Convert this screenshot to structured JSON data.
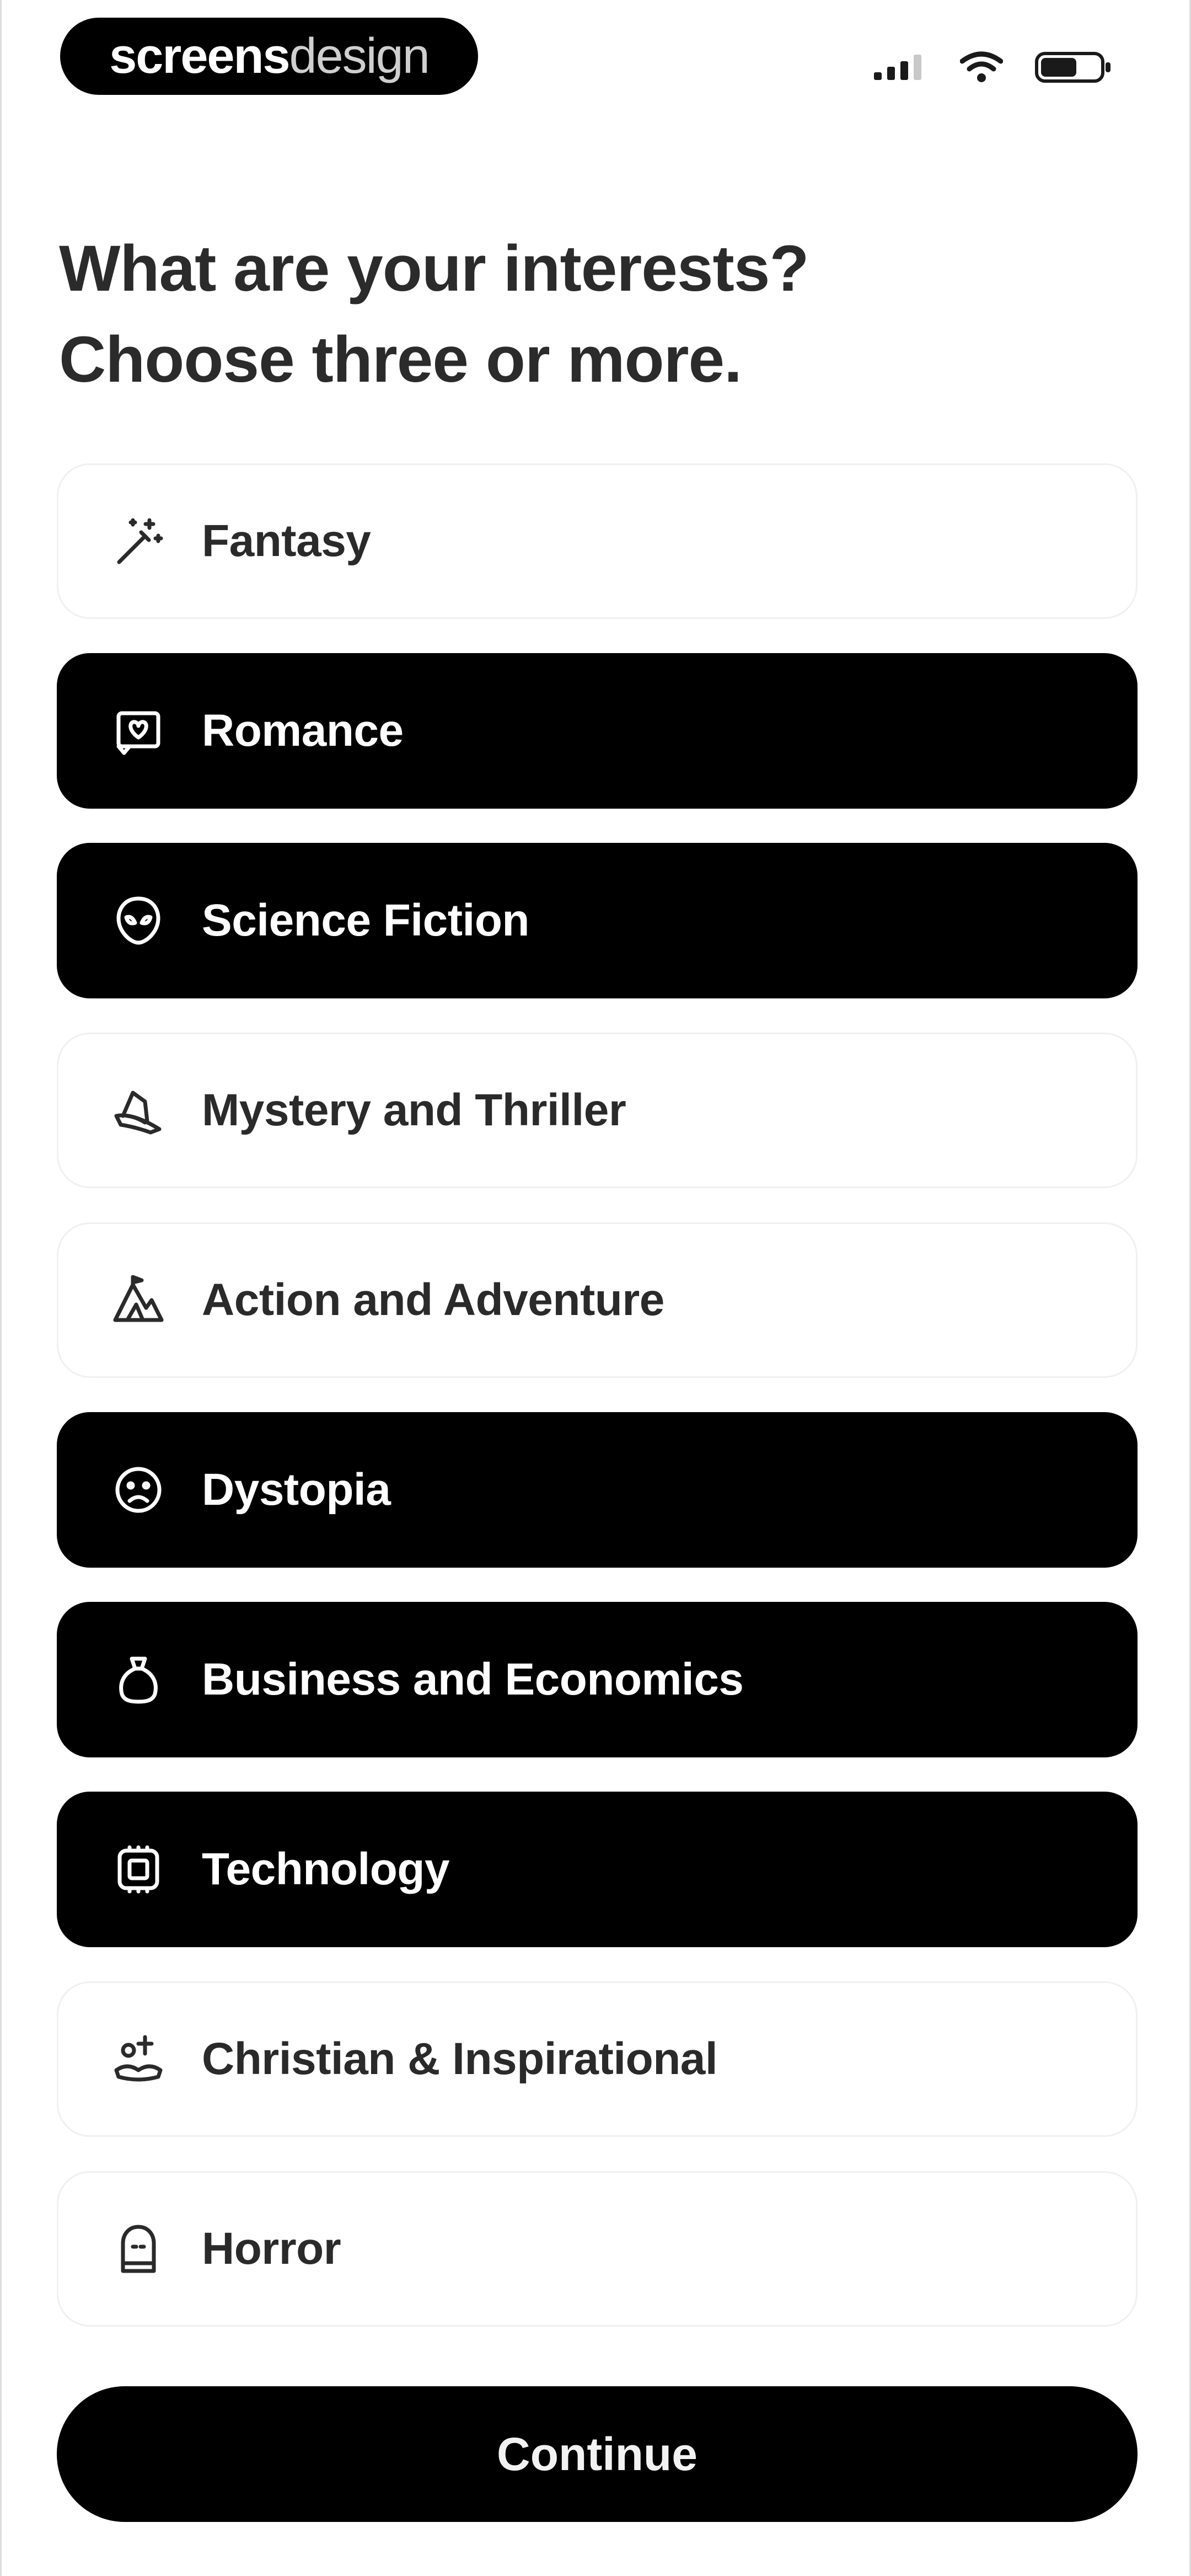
{
  "brand": {
    "bold": "screens",
    "light": "design"
  },
  "status_bar": {
    "icons": [
      "cellular-signal-icon",
      "wifi-icon",
      "battery-icon"
    ]
  },
  "heading": {
    "line1": "What are your interests?",
    "line2": "Choose three or more."
  },
  "options": [
    {
      "label": "Fantasy",
      "icon": "magic-wand-icon",
      "selected": false
    },
    {
      "label": "Romance",
      "icon": "love-letter-icon",
      "selected": true
    },
    {
      "label": "Science Fiction",
      "icon": "alien-icon",
      "selected": true
    },
    {
      "label": "Mystery and Thriller",
      "icon": "detective-hat-icon",
      "selected": false
    },
    {
      "label": "Action and Adventure",
      "icon": "mountain-icon",
      "selected": false
    },
    {
      "label": "Dystopia",
      "icon": "sad-face-icon",
      "selected": true
    },
    {
      "label": "Business and Economics",
      "icon": "money-bag-icon",
      "selected": true
    },
    {
      "label": "Technology",
      "icon": "chip-icon",
      "selected": true
    },
    {
      "label": "Christian & Inspirational",
      "icon": "hands-cross-icon",
      "selected": false
    },
    {
      "label": "Horror",
      "icon": "ghost-icon",
      "selected": false
    }
  ],
  "continue_label": "Continue",
  "colors": {
    "selected_bg": "#000000",
    "selected_text": "#ffffff",
    "unselected_bg": "#ffffff",
    "unselected_text": "#2a2a2a"
  }
}
